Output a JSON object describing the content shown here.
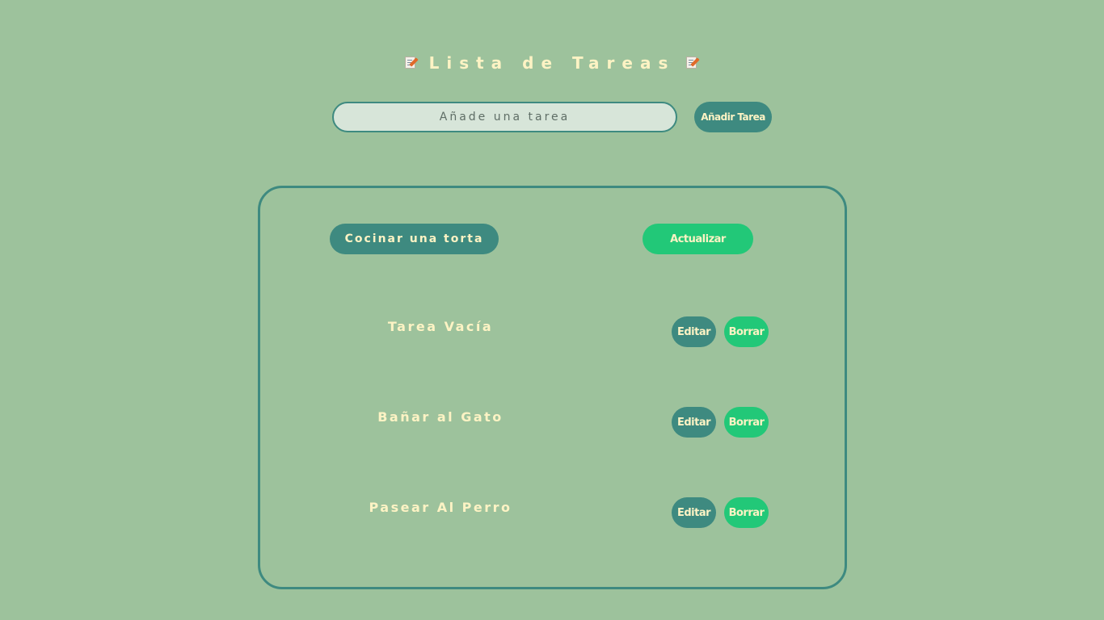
{
  "header": {
    "title": "Lista de Tareas",
    "icon": "memo-icon"
  },
  "add_form": {
    "placeholder": "Añade una tarea",
    "value": "",
    "button_label": "Añadir Tarea"
  },
  "edit_form": {
    "value": "Cocinar una torta",
    "button_label": "Actualizar"
  },
  "tasks": [
    {
      "text": "Tarea Vacía",
      "edit_label": "Editar",
      "delete_label": "Borrar"
    },
    {
      "text": "Bañar al Gato",
      "edit_label": "Editar",
      "delete_label": "Borrar"
    },
    {
      "text": "Pasear Al Perro",
      "edit_label": "Editar",
      "delete_label": "Borrar"
    }
  ],
  "colors": {
    "background": "#9dc29c",
    "teal": "#3e8a80",
    "green": "#22c878",
    "text_cream": "#fdf3c4",
    "input_bg": "#d7e5d9"
  }
}
